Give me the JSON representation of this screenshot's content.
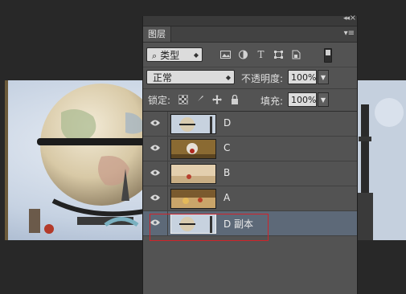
{
  "panel": {
    "title": "图层",
    "collapse_glyph": "◂◂",
    "close_glyph": "×",
    "menu_glyph": "▾≡"
  },
  "filter": {
    "search_glyph": "⌕",
    "label": "类型"
  },
  "blend": {
    "mode": "正常",
    "opacity_label": "不透明度:",
    "opacity_value": "100%"
  },
  "lock": {
    "label": "锁定:",
    "fill_label": "填充:",
    "fill_value": "100%"
  },
  "layers": [
    {
      "name": "D",
      "selected": false
    },
    {
      "name": "C",
      "selected": false
    },
    {
      "name": "B",
      "selected": false
    },
    {
      "name": "A",
      "selected": false
    },
    {
      "name": "D 副本",
      "selected": true
    }
  ],
  "colors": {
    "panel_bg": "#535353",
    "selected_layer": "#5d6978",
    "highlight": "#d0232a"
  }
}
